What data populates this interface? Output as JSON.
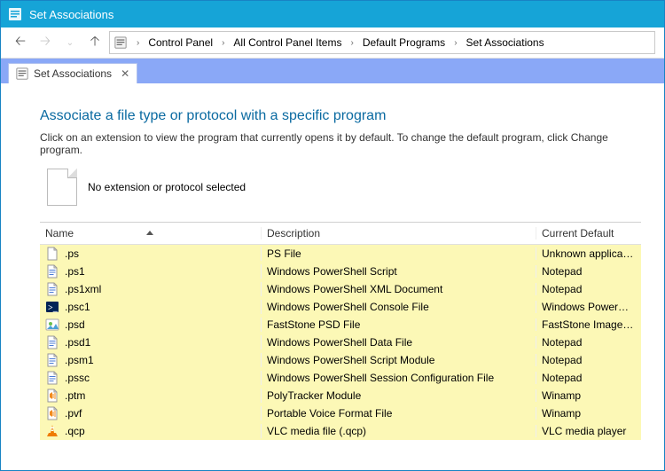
{
  "titlebar": {
    "title": "Set Associations"
  },
  "nav": {
    "breadcrumb": [
      "Control Panel",
      "All Control Panel Items",
      "Default Programs",
      "Set Associations"
    ]
  },
  "tab": {
    "label": "Set Associations"
  },
  "page": {
    "heading": "Associate a file type or protocol with a specific program",
    "subtext": "Click on an extension to view the program that currently opens it by default. To change the default program, click Change program.",
    "no_selection": "No extension or protocol selected"
  },
  "columns": {
    "name": "Name",
    "desc": "Description",
    "def": "Current Default"
  },
  "rows": [
    {
      "icon": "blank",
      "ext": ".ps",
      "desc": "PS File",
      "def": "Unknown application"
    },
    {
      "icon": "script",
      "ext": ".ps1",
      "desc": "Windows PowerShell Script",
      "def": "Notepad"
    },
    {
      "icon": "script",
      "ext": ".ps1xml",
      "desc": "Windows PowerShell XML Document",
      "def": "Notepad"
    },
    {
      "icon": "ps",
      "ext": ".psc1",
      "desc": "Windows PowerShell Console File",
      "def": "Windows PowerShell"
    },
    {
      "icon": "fs",
      "ext": ".psd",
      "desc": "FastStone PSD File",
      "def": "FastStone Image Viewer"
    },
    {
      "icon": "script",
      "ext": ".psd1",
      "desc": "Windows PowerShell Data File",
      "def": "Notepad"
    },
    {
      "icon": "script",
      "ext": ".psm1",
      "desc": "Windows PowerShell Script Module",
      "def": "Notepad"
    },
    {
      "icon": "script",
      "ext": ".pssc",
      "desc": "Windows PowerShell Session Configuration File",
      "def": "Notepad"
    },
    {
      "icon": "winamp",
      "ext": ".ptm",
      "desc": "PolyTracker Module",
      "def": "Winamp"
    },
    {
      "icon": "winamp",
      "ext": ".pvf",
      "desc": "Portable Voice Format File",
      "def": "Winamp"
    },
    {
      "icon": "vlc",
      "ext": ".qcp",
      "desc": "VLC media file (.qcp)",
      "def": "VLC media player"
    }
  ]
}
